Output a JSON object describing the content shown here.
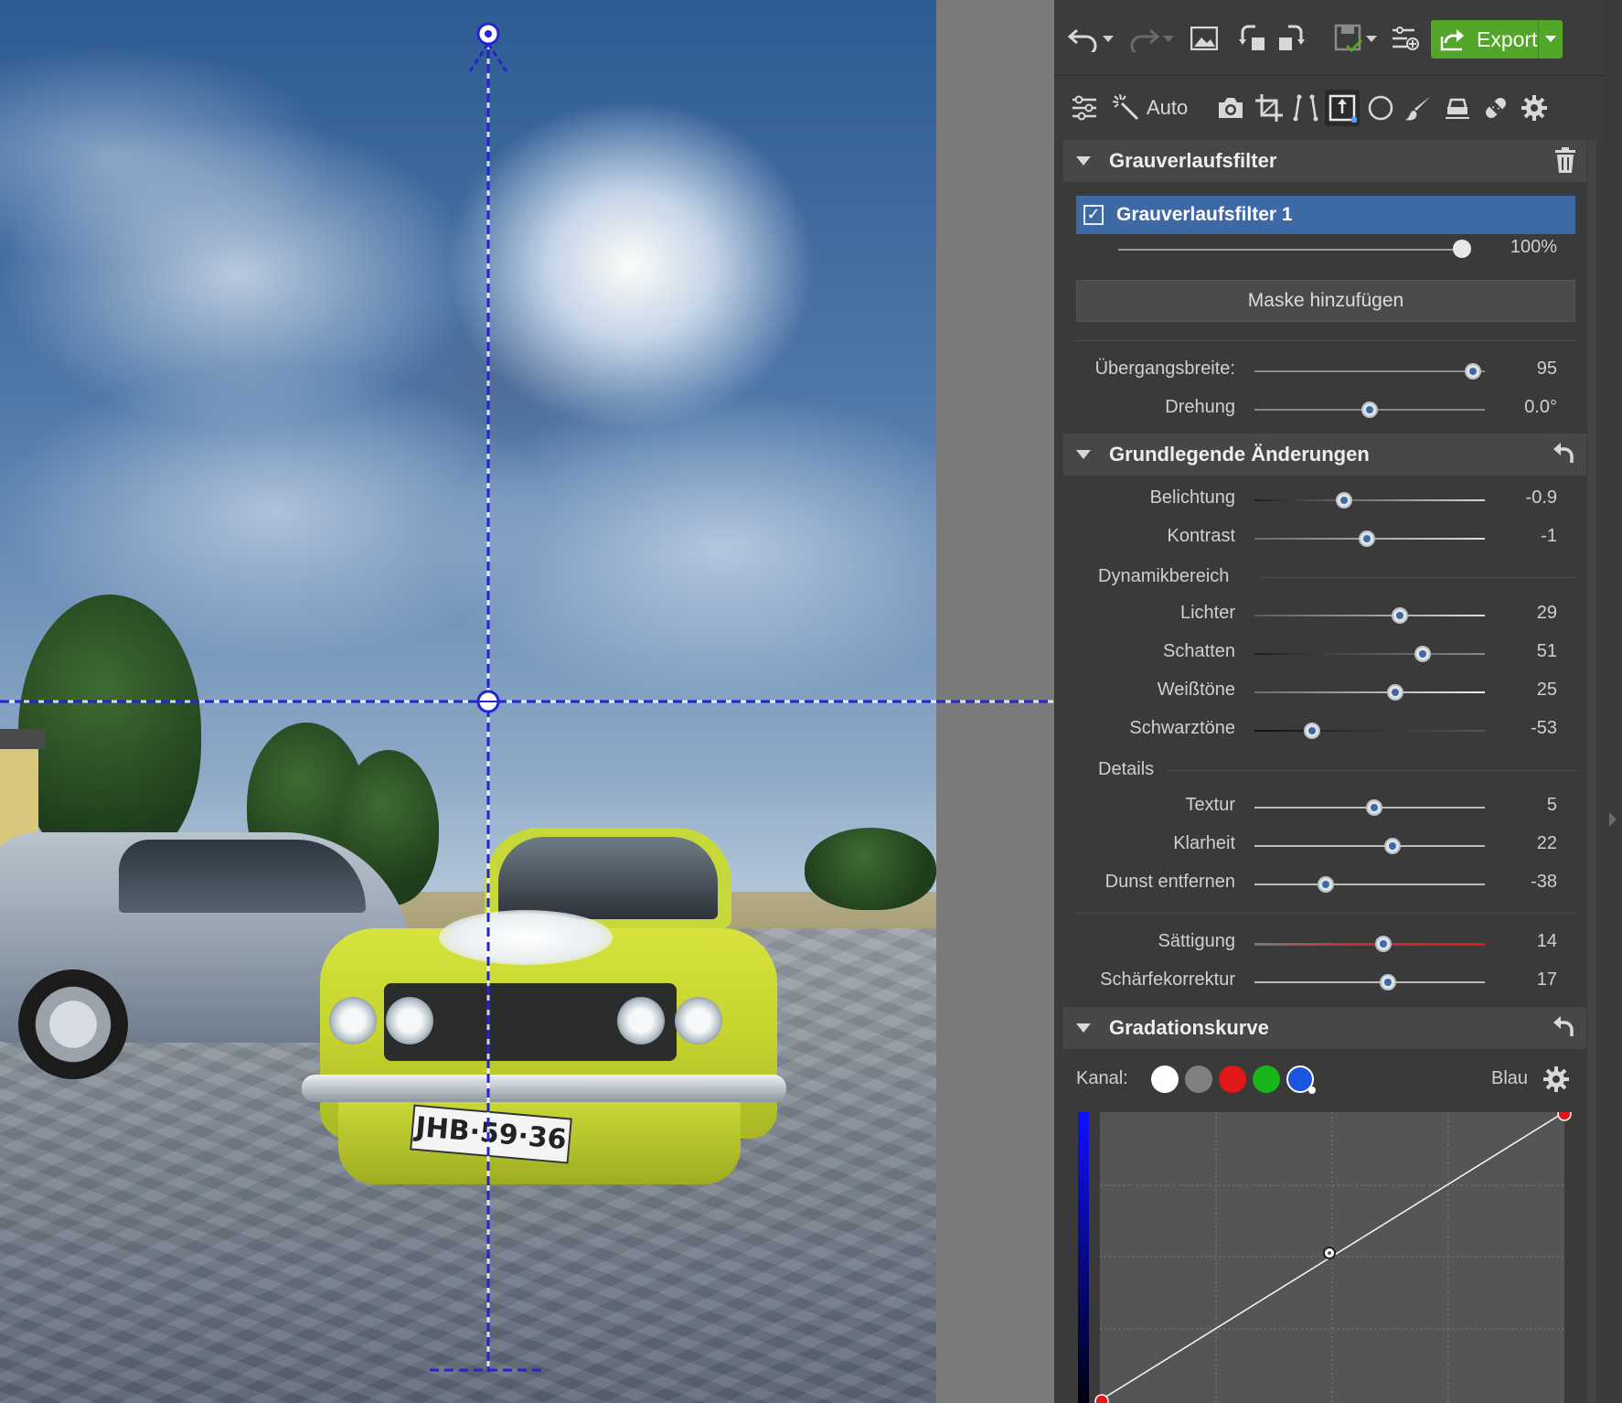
{
  "toolbar": {
    "export_label": "Export",
    "auto_label": "Auto",
    "icons": [
      "undo-icon",
      "redo-icon",
      "picture-icon",
      "rotate-left-icon",
      "rotate-right-icon",
      "save-icon",
      "presets-icon",
      "export-icon",
      "adjustments-icon",
      "magic-wand-icon",
      "camera-icon",
      "crop-icon",
      "perspective-icon",
      "gradient-filter-icon",
      "radial-filter-icon",
      "brush-icon",
      "eraser-icon",
      "healing-icon",
      "settings-icon"
    ]
  },
  "gradient_filter": {
    "section_title": "Grauverlaufsfilter",
    "filter_name": "Grauverlaufsfilter 1",
    "filter_checked": true,
    "opacity": {
      "value": "100%",
      "fraction": 1.0
    },
    "mask_button": "Maske hinzufügen",
    "transition_width": {
      "label": "Übergangsbreite:",
      "value": "95",
      "fraction": 0.95
    },
    "rotation": {
      "label": "Drehung",
      "value": "0.0°",
      "fraction": 0.5
    }
  },
  "basic": {
    "section_title": "Grundlegende Änderungen",
    "exposure": {
      "label": "Belichtung",
      "value": "-0.9",
      "fraction": 0.39
    },
    "contrast": {
      "label": "Kontrast",
      "value": "-1",
      "fraction": 0.49
    },
    "dynamic_range_title": "Dynamikbereich",
    "highlights": {
      "label": "Lichter",
      "value": "29",
      "fraction": 0.63
    },
    "shadows": {
      "label": "Schatten",
      "value": "51",
      "fraction": 0.73
    },
    "whites": {
      "label": "Weißtöne",
      "value": "25",
      "fraction": 0.61
    },
    "blacks": {
      "label": "Schwarztöne",
      "value": "-53",
      "fraction": 0.25
    },
    "details_title": "Details",
    "texture": {
      "label": "Textur",
      "value": "5",
      "fraction": 0.52
    },
    "clarity": {
      "label": "Klarheit",
      "value": "22",
      "fraction": 0.6
    },
    "dehaze": {
      "label": "Dunst entfernen",
      "value": "-38",
      "fraction": 0.31
    },
    "saturation": {
      "label": "Sättigung",
      "value": "14",
      "fraction": 0.56
    },
    "sharpness": {
      "label": "Schärfekorrektur",
      "value": "17",
      "fraction": 0.58
    }
  },
  "curve": {
    "section_title": "Gradationskurve",
    "channel_label": "Kanal:",
    "channel_selected": "Blau",
    "channels": [
      "#ffffff",
      "#808080",
      "#e01818",
      "#19b619",
      "#1c56e0"
    ]
  },
  "photo": {
    "plate_text": "JHB·59·36"
  },
  "colors": {
    "accent_blue": "#3d6aa6",
    "export_green": "#52a728",
    "guide_line": "#2424d0"
  }
}
